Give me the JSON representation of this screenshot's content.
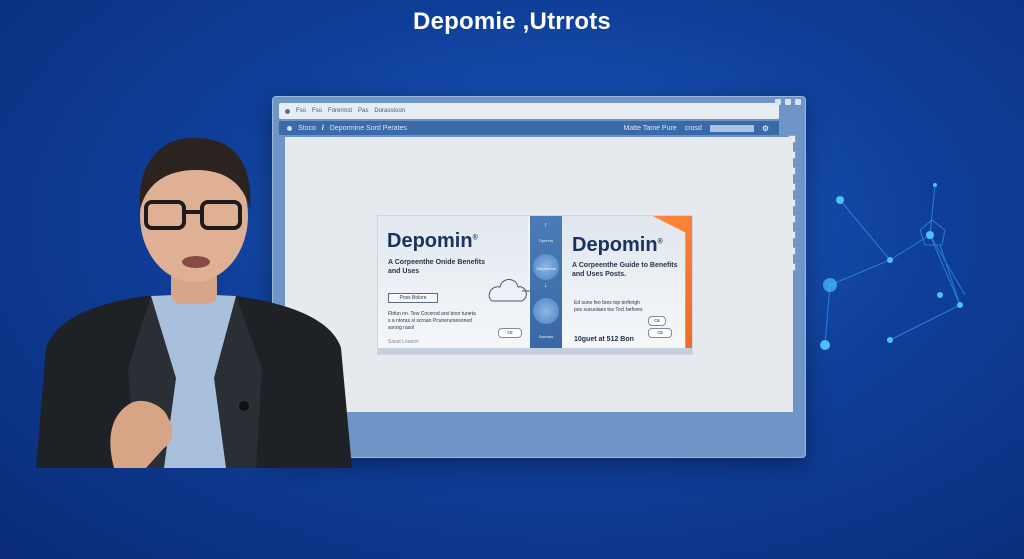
{
  "headline": "Depomie ,Utrrots",
  "window": {
    "menu_items": [
      "Fso",
      "Fso",
      "Forermst",
      "Pas",
      "Dorasstoon"
    ],
    "address": {
      "home_label": "Stoco",
      "slash": "/",
      "breadcrumb": "Depormine Sord Perates",
      "right_label": "Matte Tame Pure",
      "right_label2": "crosd",
      "url_value": ""
    }
  },
  "banner": {
    "left": {
      "brand": "Depomin",
      "reg_mark": "®",
      "subtitle": "A Corpeenthe Onide Benefits and Uses",
      "button_label": "Poss Bolore",
      "para": "Fbfun nn. Tew Cocerod arsi boor tuneta s a ntoras sl scroan Pcunerursesoned sorsrg rasol",
      "mini_ctrl": "ce",
      "footer": "Sasat Leaoon"
    },
    "center": {
      "arrow_up": "↑",
      "label_top": "Gpenrrs",
      "label_mid": "Stepenrros",
      "label_bottom": "Sstenas",
      "arrow_down": "↓"
    },
    "right": {
      "brand": "Depomin",
      "reg_mark": "®",
      "subtitle": "A Corpeenthe Guide to Benefits and Uses Posts.",
      "para": "Ed sune feo bres top terferigh pos sucuoiaes tos Toct befores",
      "mini_ctrl_1": "ca",
      "mini_ctrl_2": "ca",
      "footer": "10guet at 512 Bon"
    }
  }
}
